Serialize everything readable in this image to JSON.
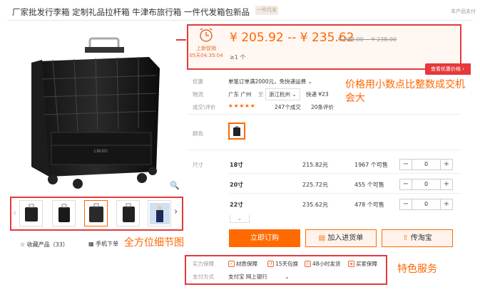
{
  "product": {
    "title": "厂家批发行李箱 定制礼品拉杆箱 牛津布旅行箱 一件代发箱包新品",
    "tag": "一件代发",
    "support_link": "本产品支付"
  },
  "price": {
    "promo_label": "上新促销",
    "promo_countdown": "05天04:35:04",
    "range": "¥ 205.92 -- ¥ 235.62",
    "original_range": "¥ 208.00 -- ¥ 238.00",
    "moq": "≥1 个",
    "compare_button": "查看优惠价格"
  },
  "attributes": {
    "discount_label": "优惠",
    "discount_value": "单笔订单满2000元，免快递运费",
    "shipping_label": "物流",
    "shipping_from": "广东 广州",
    "shipping_to_word": "至",
    "shipping_to": "浙江杭州",
    "shipping_method": "快递 ¥23",
    "review_label": "成交\\评价",
    "stars": "★★★★★",
    "deals": "247个成交",
    "reviews": "20条评价",
    "color_label": "颜色",
    "size_label": "尺寸"
  },
  "sizes": [
    {
      "name": "18寸",
      "price": "215.82元",
      "stock": "1967 个可售",
      "qty": "0"
    },
    {
      "name": "20寸",
      "price": "225.72元",
      "stock": "455 个可售",
      "qty": "0"
    },
    {
      "name": "22寸",
      "price": "235.62元",
      "stock": "478 个可售",
      "qty": "0"
    }
  ],
  "actions": {
    "order": "立即订购",
    "cart": "加入进货单",
    "taobao": "传淘宝"
  },
  "sidebar": {
    "favorite": "收藏产品（33）",
    "mobile": "手机下单"
  },
  "service": {
    "guarantee_label": "实力保障",
    "items": [
      "材质保障",
      "15天包换",
      "48小时发货",
      "买家保障"
    ],
    "payment_label": "支付方式",
    "payment_methods": "支付宝   网上银行"
  },
  "annotations": {
    "price_note": "价格用小数点比整数成交机会大",
    "thumb_note": "全方位细节图",
    "service_note": "特色服务"
  },
  "colors": {
    "accent": "#ff6a00",
    "highlight_red": "#e4393c",
    "price": "#ff6600"
  }
}
